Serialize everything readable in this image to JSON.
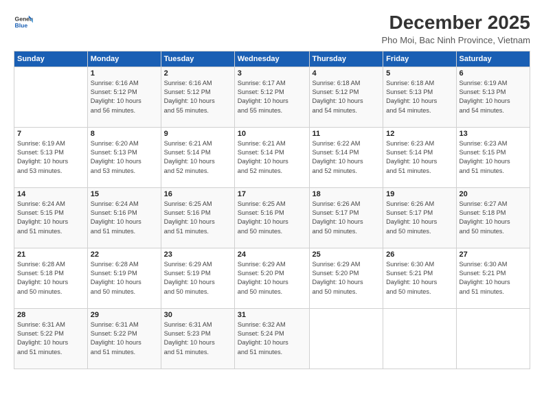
{
  "header": {
    "logo_line1": "General",
    "logo_line2": "Blue",
    "month_title": "December 2025",
    "location": "Pho Moi, Bac Ninh Province, Vietnam"
  },
  "days_of_week": [
    "Sunday",
    "Monday",
    "Tuesday",
    "Wednesday",
    "Thursday",
    "Friday",
    "Saturday"
  ],
  "weeks": [
    [
      {
        "day": "",
        "info": ""
      },
      {
        "day": "1",
        "info": "Sunrise: 6:16 AM\nSunset: 5:12 PM\nDaylight: 10 hours\nand 56 minutes."
      },
      {
        "day": "2",
        "info": "Sunrise: 6:16 AM\nSunset: 5:12 PM\nDaylight: 10 hours\nand 55 minutes."
      },
      {
        "day": "3",
        "info": "Sunrise: 6:17 AM\nSunset: 5:12 PM\nDaylight: 10 hours\nand 55 minutes."
      },
      {
        "day": "4",
        "info": "Sunrise: 6:18 AM\nSunset: 5:12 PM\nDaylight: 10 hours\nand 54 minutes."
      },
      {
        "day": "5",
        "info": "Sunrise: 6:18 AM\nSunset: 5:13 PM\nDaylight: 10 hours\nand 54 minutes."
      },
      {
        "day": "6",
        "info": "Sunrise: 6:19 AM\nSunset: 5:13 PM\nDaylight: 10 hours\nand 54 minutes."
      }
    ],
    [
      {
        "day": "7",
        "info": "Sunrise: 6:19 AM\nSunset: 5:13 PM\nDaylight: 10 hours\nand 53 minutes."
      },
      {
        "day": "8",
        "info": "Sunrise: 6:20 AM\nSunset: 5:13 PM\nDaylight: 10 hours\nand 53 minutes."
      },
      {
        "day": "9",
        "info": "Sunrise: 6:21 AM\nSunset: 5:14 PM\nDaylight: 10 hours\nand 52 minutes."
      },
      {
        "day": "10",
        "info": "Sunrise: 6:21 AM\nSunset: 5:14 PM\nDaylight: 10 hours\nand 52 minutes."
      },
      {
        "day": "11",
        "info": "Sunrise: 6:22 AM\nSunset: 5:14 PM\nDaylight: 10 hours\nand 52 minutes."
      },
      {
        "day": "12",
        "info": "Sunrise: 6:23 AM\nSunset: 5:14 PM\nDaylight: 10 hours\nand 51 minutes."
      },
      {
        "day": "13",
        "info": "Sunrise: 6:23 AM\nSunset: 5:15 PM\nDaylight: 10 hours\nand 51 minutes."
      }
    ],
    [
      {
        "day": "14",
        "info": "Sunrise: 6:24 AM\nSunset: 5:15 PM\nDaylight: 10 hours\nand 51 minutes."
      },
      {
        "day": "15",
        "info": "Sunrise: 6:24 AM\nSunset: 5:16 PM\nDaylight: 10 hours\nand 51 minutes."
      },
      {
        "day": "16",
        "info": "Sunrise: 6:25 AM\nSunset: 5:16 PM\nDaylight: 10 hours\nand 51 minutes."
      },
      {
        "day": "17",
        "info": "Sunrise: 6:25 AM\nSunset: 5:16 PM\nDaylight: 10 hours\nand 50 minutes."
      },
      {
        "day": "18",
        "info": "Sunrise: 6:26 AM\nSunset: 5:17 PM\nDaylight: 10 hours\nand 50 minutes."
      },
      {
        "day": "19",
        "info": "Sunrise: 6:26 AM\nSunset: 5:17 PM\nDaylight: 10 hours\nand 50 minutes."
      },
      {
        "day": "20",
        "info": "Sunrise: 6:27 AM\nSunset: 5:18 PM\nDaylight: 10 hours\nand 50 minutes."
      }
    ],
    [
      {
        "day": "21",
        "info": "Sunrise: 6:28 AM\nSunset: 5:18 PM\nDaylight: 10 hours\nand 50 minutes."
      },
      {
        "day": "22",
        "info": "Sunrise: 6:28 AM\nSunset: 5:19 PM\nDaylight: 10 hours\nand 50 minutes."
      },
      {
        "day": "23",
        "info": "Sunrise: 6:29 AM\nSunset: 5:19 PM\nDaylight: 10 hours\nand 50 minutes."
      },
      {
        "day": "24",
        "info": "Sunrise: 6:29 AM\nSunset: 5:20 PM\nDaylight: 10 hours\nand 50 minutes."
      },
      {
        "day": "25",
        "info": "Sunrise: 6:29 AM\nSunset: 5:20 PM\nDaylight: 10 hours\nand 50 minutes."
      },
      {
        "day": "26",
        "info": "Sunrise: 6:30 AM\nSunset: 5:21 PM\nDaylight: 10 hours\nand 50 minutes."
      },
      {
        "day": "27",
        "info": "Sunrise: 6:30 AM\nSunset: 5:21 PM\nDaylight: 10 hours\nand 51 minutes."
      }
    ],
    [
      {
        "day": "28",
        "info": "Sunrise: 6:31 AM\nSunset: 5:22 PM\nDaylight: 10 hours\nand 51 minutes."
      },
      {
        "day": "29",
        "info": "Sunrise: 6:31 AM\nSunset: 5:22 PM\nDaylight: 10 hours\nand 51 minutes."
      },
      {
        "day": "30",
        "info": "Sunrise: 6:31 AM\nSunset: 5:23 PM\nDaylight: 10 hours\nand 51 minutes."
      },
      {
        "day": "31",
        "info": "Sunrise: 6:32 AM\nSunset: 5:24 PM\nDaylight: 10 hours\nand 51 minutes."
      },
      {
        "day": "",
        "info": ""
      },
      {
        "day": "",
        "info": ""
      },
      {
        "day": "",
        "info": ""
      }
    ]
  ]
}
